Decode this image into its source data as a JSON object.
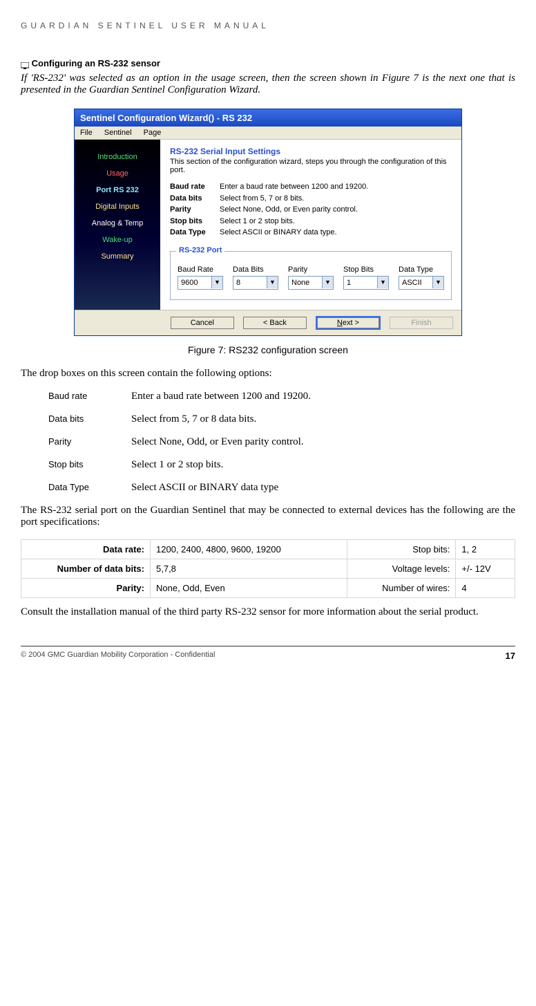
{
  "header": "GUARDIAN SENTINEL USER MANUAL",
  "section_title": "Configuring an RS-232 sensor",
  "intro": "If 'RS-232' was selected as an option in the usage screen, then the screen shown in Figure 7 is the next one that is presented in the Guardian Sentinel Configuration Wizard.",
  "wizard": {
    "titlebar": "Sentinel Configuration Wizard() - RS 232",
    "menu": [
      "File",
      "Sentinel",
      "Page"
    ],
    "sidebar": [
      {
        "label": "Introduction",
        "cls": "nav-green"
      },
      {
        "label": "Usage",
        "cls": "nav-red"
      },
      {
        "label": "Port RS 232",
        "cls": "nav-active"
      },
      {
        "label": "Digital Inputs",
        "cls": "nav-yellow"
      },
      {
        "label": "Analog & Temp",
        "cls": ""
      },
      {
        "label": "Wake-up",
        "cls": "nav-green"
      },
      {
        "label": "Summary",
        "cls": "nav-yellow"
      }
    ],
    "heading": "RS-232 Serial Input Settings",
    "subheading": "This section of the configuration wizard, steps you through the configuration of this port.",
    "params": [
      {
        "name": "Baud rate",
        "desc": "Enter a baud rate between 1200 and 19200."
      },
      {
        "name": "Data bits",
        "desc": "Select from 5, 7 or 8 bits."
      },
      {
        "name": "Parity",
        "desc": "Select None, Odd, or Even parity control."
      },
      {
        "name": "Stop bits",
        "desc": "Select 1 or 2 stop bits."
      },
      {
        "name": "Data Type",
        "desc": "Select ASCII or BINARY data type."
      }
    ],
    "fieldset_legend": "RS-232 Port",
    "fields": [
      {
        "label": "Baud Rate",
        "value": "9600"
      },
      {
        "label": "Data Bits",
        "value": "8"
      },
      {
        "label": "Parity",
        "value": "None"
      },
      {
        "label": "Stop Bits",
        "value": "1"
      },
      {
        "label": "Data Type",
        "value": "ASCII"
      }
    ],
    "buttons": {
      "cancel": "Cancel",
      "back": "< Back",
      "next": "Next >",
      "finish": "Finish"
    }
  },
  "figure_caption": "Figure 7: RS232 configuration screen",
  "lead_text": "The drop boxes on this screen contain the following options:",
  "options": [
    {
      "label": "Baud rate",
      "desc": "Enter a baud rate between 1200 and 19200."
    },
    {
      "label": "Data bits",
      "desc": "Select from 5, 7 or 8 data bits."
    },
    {
      "label": "Parity",
      "desc": "Select None, Odd, or Even parity control."
    },
    {
      "label": "Stop bits",
      "desc": "Select 1 or 2 stop bits."
    },
    {
      "label": "Data Type",
      "desc": "Select ASCII or BINARY data type"
    }
  ],
  "spec_intro": "The RS-232 serial port on the Guardian Sentinel that may be connected to external devices has the following are the port specifications:",
  "spec_table": [
    {
      "l": "Data rate:",
      "v": "1200, 2400, 4800, 9600, 19200",
      "l2": "Stop bits:",
      "v2": "1, 2"
    },
    {
      "l": "Number of data bits:",
      "v": "5,7,8",
      "l2": "Voltage levels:",
      "v2": "+/- 12V"
    },
    {
      "l": "Parity:",
      "v": "None, Odd, Even",
      "l2": "Number of wires:",
      "v2": "4"
    }
  ],
  "consult": "Consult the installation manual of the third party RS-232 sensor for more information about the serial product.",
  "footer_left": "© 2004 GMC Guardian Mobility Corporation - Confidential",
  "footer_page": "17"
}
